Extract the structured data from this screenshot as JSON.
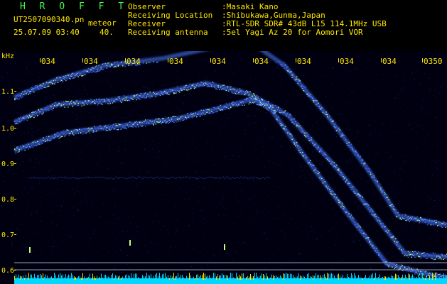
{
  "header": {
    "app_title": "H R O F F T",
    "file_name": "UT2507090340.pn",
    "file_suffix": "meteor",
    "datetime": "25.07.09 03:40",
    "gain_value": "40.",
    "fields": [
      {
        "label": "Observer",
        "value": ":Masaki Kano"
      },
      {
        "label": "Receiving Location",
        "value": ":Shibukawa,Gunma,Japan"
      },
      {
        "label": "Receiver",
        "value": ":RTL-SDR SDR# 43dB L15 114.1MHz USB"
      },
      {
        "label": "Receiving antenna",
        "value": ":5el Yagi Az 20 for Aomori VOR"
      }
    ]
  },
  "spectrogram": {
    "freq_unit": "kHz",
    "freq_ticks": [
      "1.1",
      "1.0",
      "0.9",
      "0.8",
      "0.7",
      "0.6"
    ],
    "time_ticks": [
      "034",
      "034",
      "034",
      "034",
      "034",
      "034",
      "034",
      "034",
      "034",
      "0350"
    ],
    "colors": {
      "label": "#ffe800",
      "signal": "#4a7dff",
      "background": "#000010",
      "baseline": "#00d8ff"
    }
  }
}
